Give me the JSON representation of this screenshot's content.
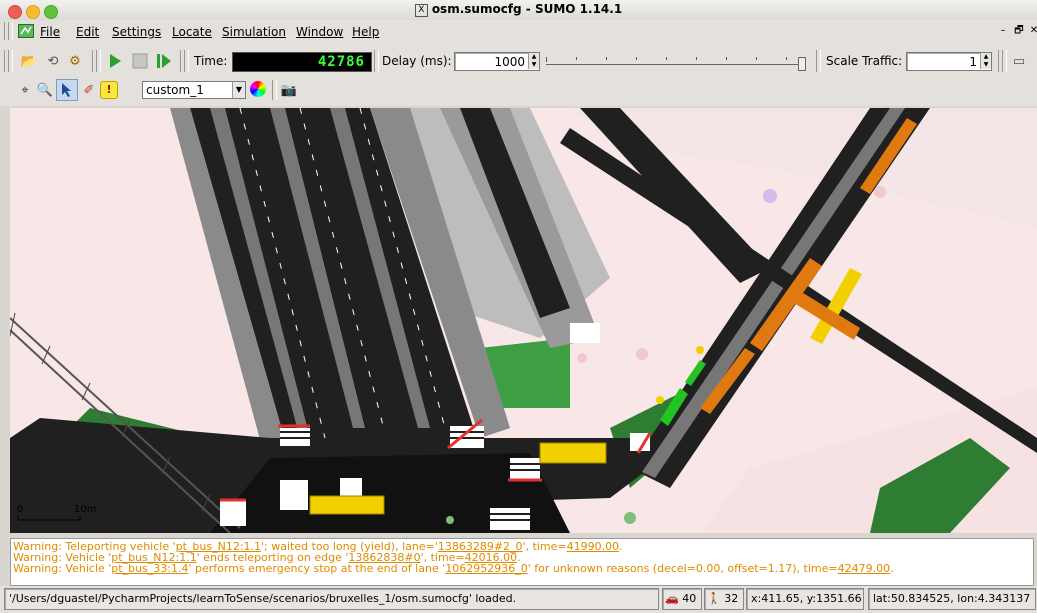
{
  "window": {
    "title": "osm.sumocfg - SUMO 1.14.1"
  },
  "menu": {
    "items": [
      "File",
      "Edit",
      "Settings",
      "Locate",
      "Simulation",
      "Window",
      "Help"
    ]
  },
  "toolbar": {
    "time_label": "Time:",
    "time_value": "42786",
    "delay_label": "Delay (ms):",
    "delay_value": "1000",
    "scale_label": "Scale Traffic:",
    "scale_value": "1"
  },
  "view_toolbar": {
    "scheme_select": "custom_1"
  },
  "map": {
    "scale_start": "0",
    "scale_end": "10m"
  },
  "log": [
    {
      "pre": "Warning: Teleporting vehicle '",
      "l1": "pt_bus_N12:1.1",
      "mid": "'; waited too long (yield), lane='",
      "l2": "13863289#2_0",
      "mid2": "', time=",
      "l3": "41990.00",
      "post": "."
    },
    {
      "pre": "Warning: Vehicle '",
      "l1": "pt_bus_N12:1.1",
      "mid": "' ends teleporting on edge '",
      "l2": "13862838#0",
      "mid2": "', time=",
      "l3": "42016.00",
      "post": "."
    },
    {
      "pre": "Warning: Vehicle '",
      "l1": "pt_bus_33:1.4",
      "mid": "' performs emergency stop at the end of lane '",
      "l2": "1062952936_0",
      "mid2": "' for unknown reasons (decel=0.00, offset=1.17), time=",
      "l3": "42479.00",
      "post": "."
    }
  ],
  "status": {
    "message": "'/Users/dguastel/PycharmProjects/learnToSense/scenarios/bruxelles_1/osm.sumocfg' loaded.",
    "vehicles": "40",
    "persons": "32",
    "coords": "x:411.65, y:1351.66",
    "geo": "lat:50.834525, lon:4.343137"
  },
  "colors": {
    "road": "#202020",
    "sidewalk": "#808080",
    "grass": "#2e7d32",
    "building": "#f9e7e7",
    "bus_orange": "#e07a10",
    "bus_yellow": "#f2d000",
    "car_green": "#22c322",
    "log_text": "#e08a00"
  },
  "icons": [
    "open-icon",
    "reload-icon",
    "save-icon",
    "play-icon",
    "stop-icon",
    "step-icon",
    "recenter-icon",
    "locate-icon",
    "select-icon",
    "edit-icon",
    "help-icon",
    "color-wheel-icon",
    "screenshot-icon",
    "car-icon",
    "person-icon"
  ]
}
